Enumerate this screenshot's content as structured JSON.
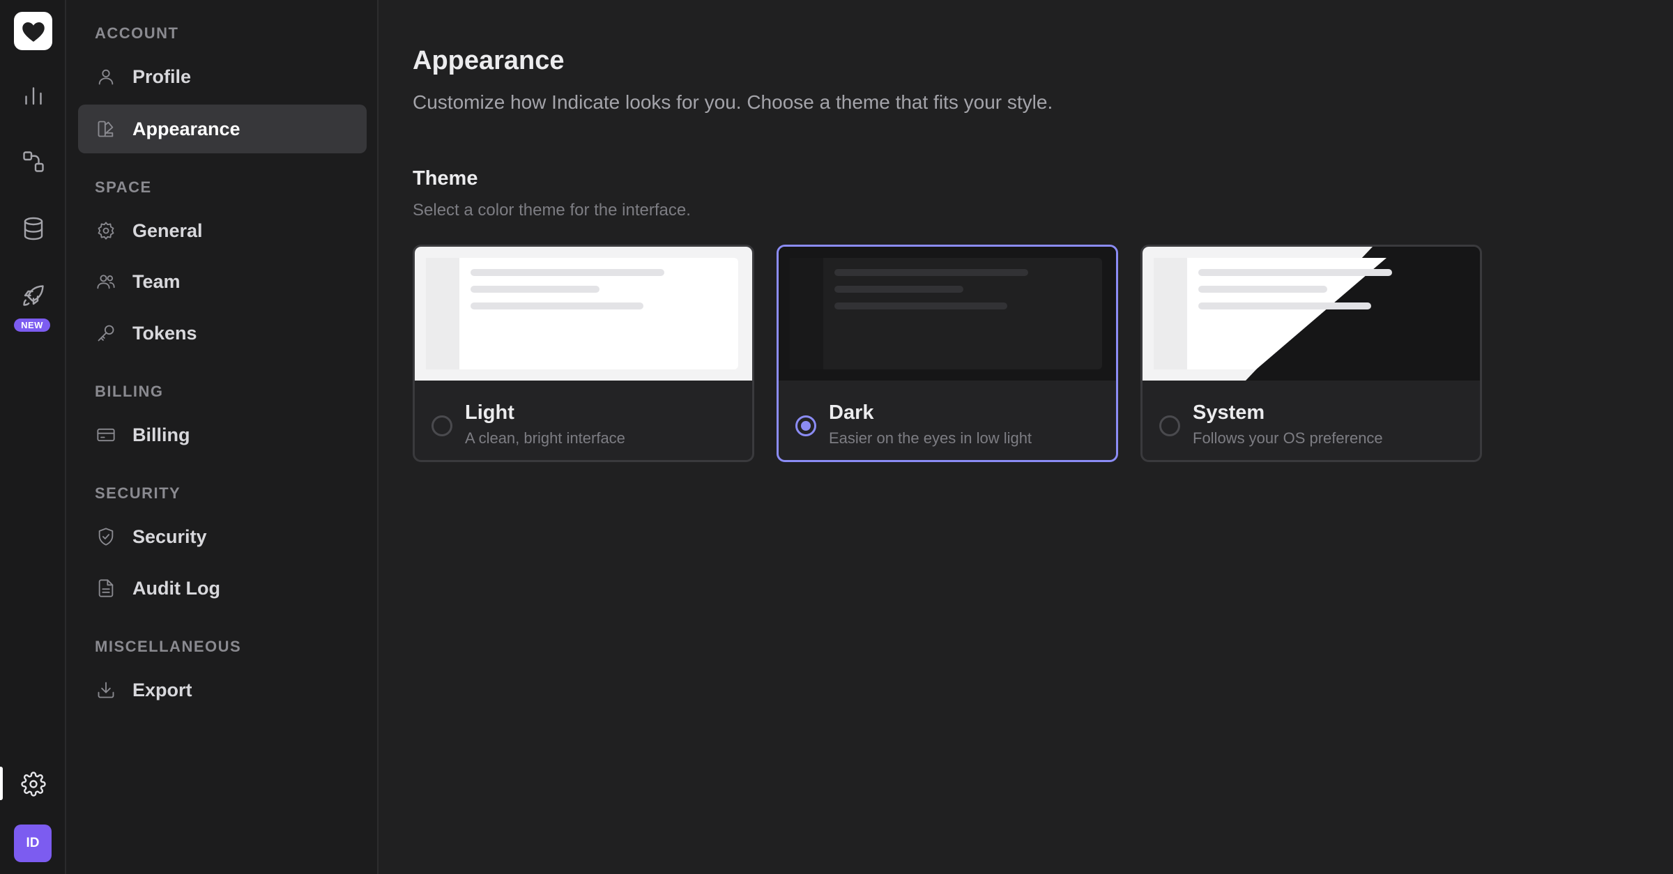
{
  "rail": {
    "logo_icon": "heart-icon",
    "items": [
      {
        "icon": "bar-chart-icon"
      },
      {
        "icon": "workflow-icon"
      },
      {
        "icon": "database-icon"
      },
      {
        "icon": "rocket-icon",
        "badge": "NEW"
      },
      {
        "icon": "gear-icon"
      }
    ],
    "avatar_initials": "ID",
    "accent_color": "#7c5cf0"
  },
  "nav": {
    "sections": [
      {
        "title": "ACCOUNT",
        "items": [
          {
            "label": "Profile",
            "icon": "user-icon"
          },
          {
            "label": "Appearance",
            "icon": "palette-icon",
            "active": true
          }
        ]
      },
      {
        "title": "SPACE",
        "items": [
          {
            "label": "General",
            "icon": "gear-icon"
          },
          {
            "label": "Team",
            "icon": "users-icon"
          },
          {
            "label": "Tokens",
            "icon": "key-icon"
          }
        ]
      },
      {
        "title": "BILLING",
        "items": [
          {
            "label": "Billing",
            "icon": "credit-card-icon"
          }
        ]
      },
      {
        "title": "SECURITY",
        "items": [
          {
            "label": "Security",
            "icon": "shield-check-icon"
          },
          {
            "label": "Audit Log",
            "icon": "file-text-icon"
          }
        ]
      },
      {
        "title": "MISCELLANEOUS",
        "items": [
          {
            "label": "Export",
            "icon": "download-icon"
          }
        ]
      }
    ]
  },
  "main": {
    "title": "Appearance",
    "subtitle": "Customize how Indicate looks for you. Choose a theme that fits your style.",
    "theme_section": {
      "title": "Theme",
      "description": "Select a color theme for the interface.",
      "options": [
        {
          "label": "Light",
          "description": "A clean, bright interface",
          "selected": false
        },
        {
          "label": "Dark",
          "description": "Easier on the eyes in low light",
          "selected": true
        },
        {
          "label": "System",
          "description": "Follows your OS preference",
          "selected": false
        }
      ],
      "selected_color": "#8b8cf5"
    }
  }
}
